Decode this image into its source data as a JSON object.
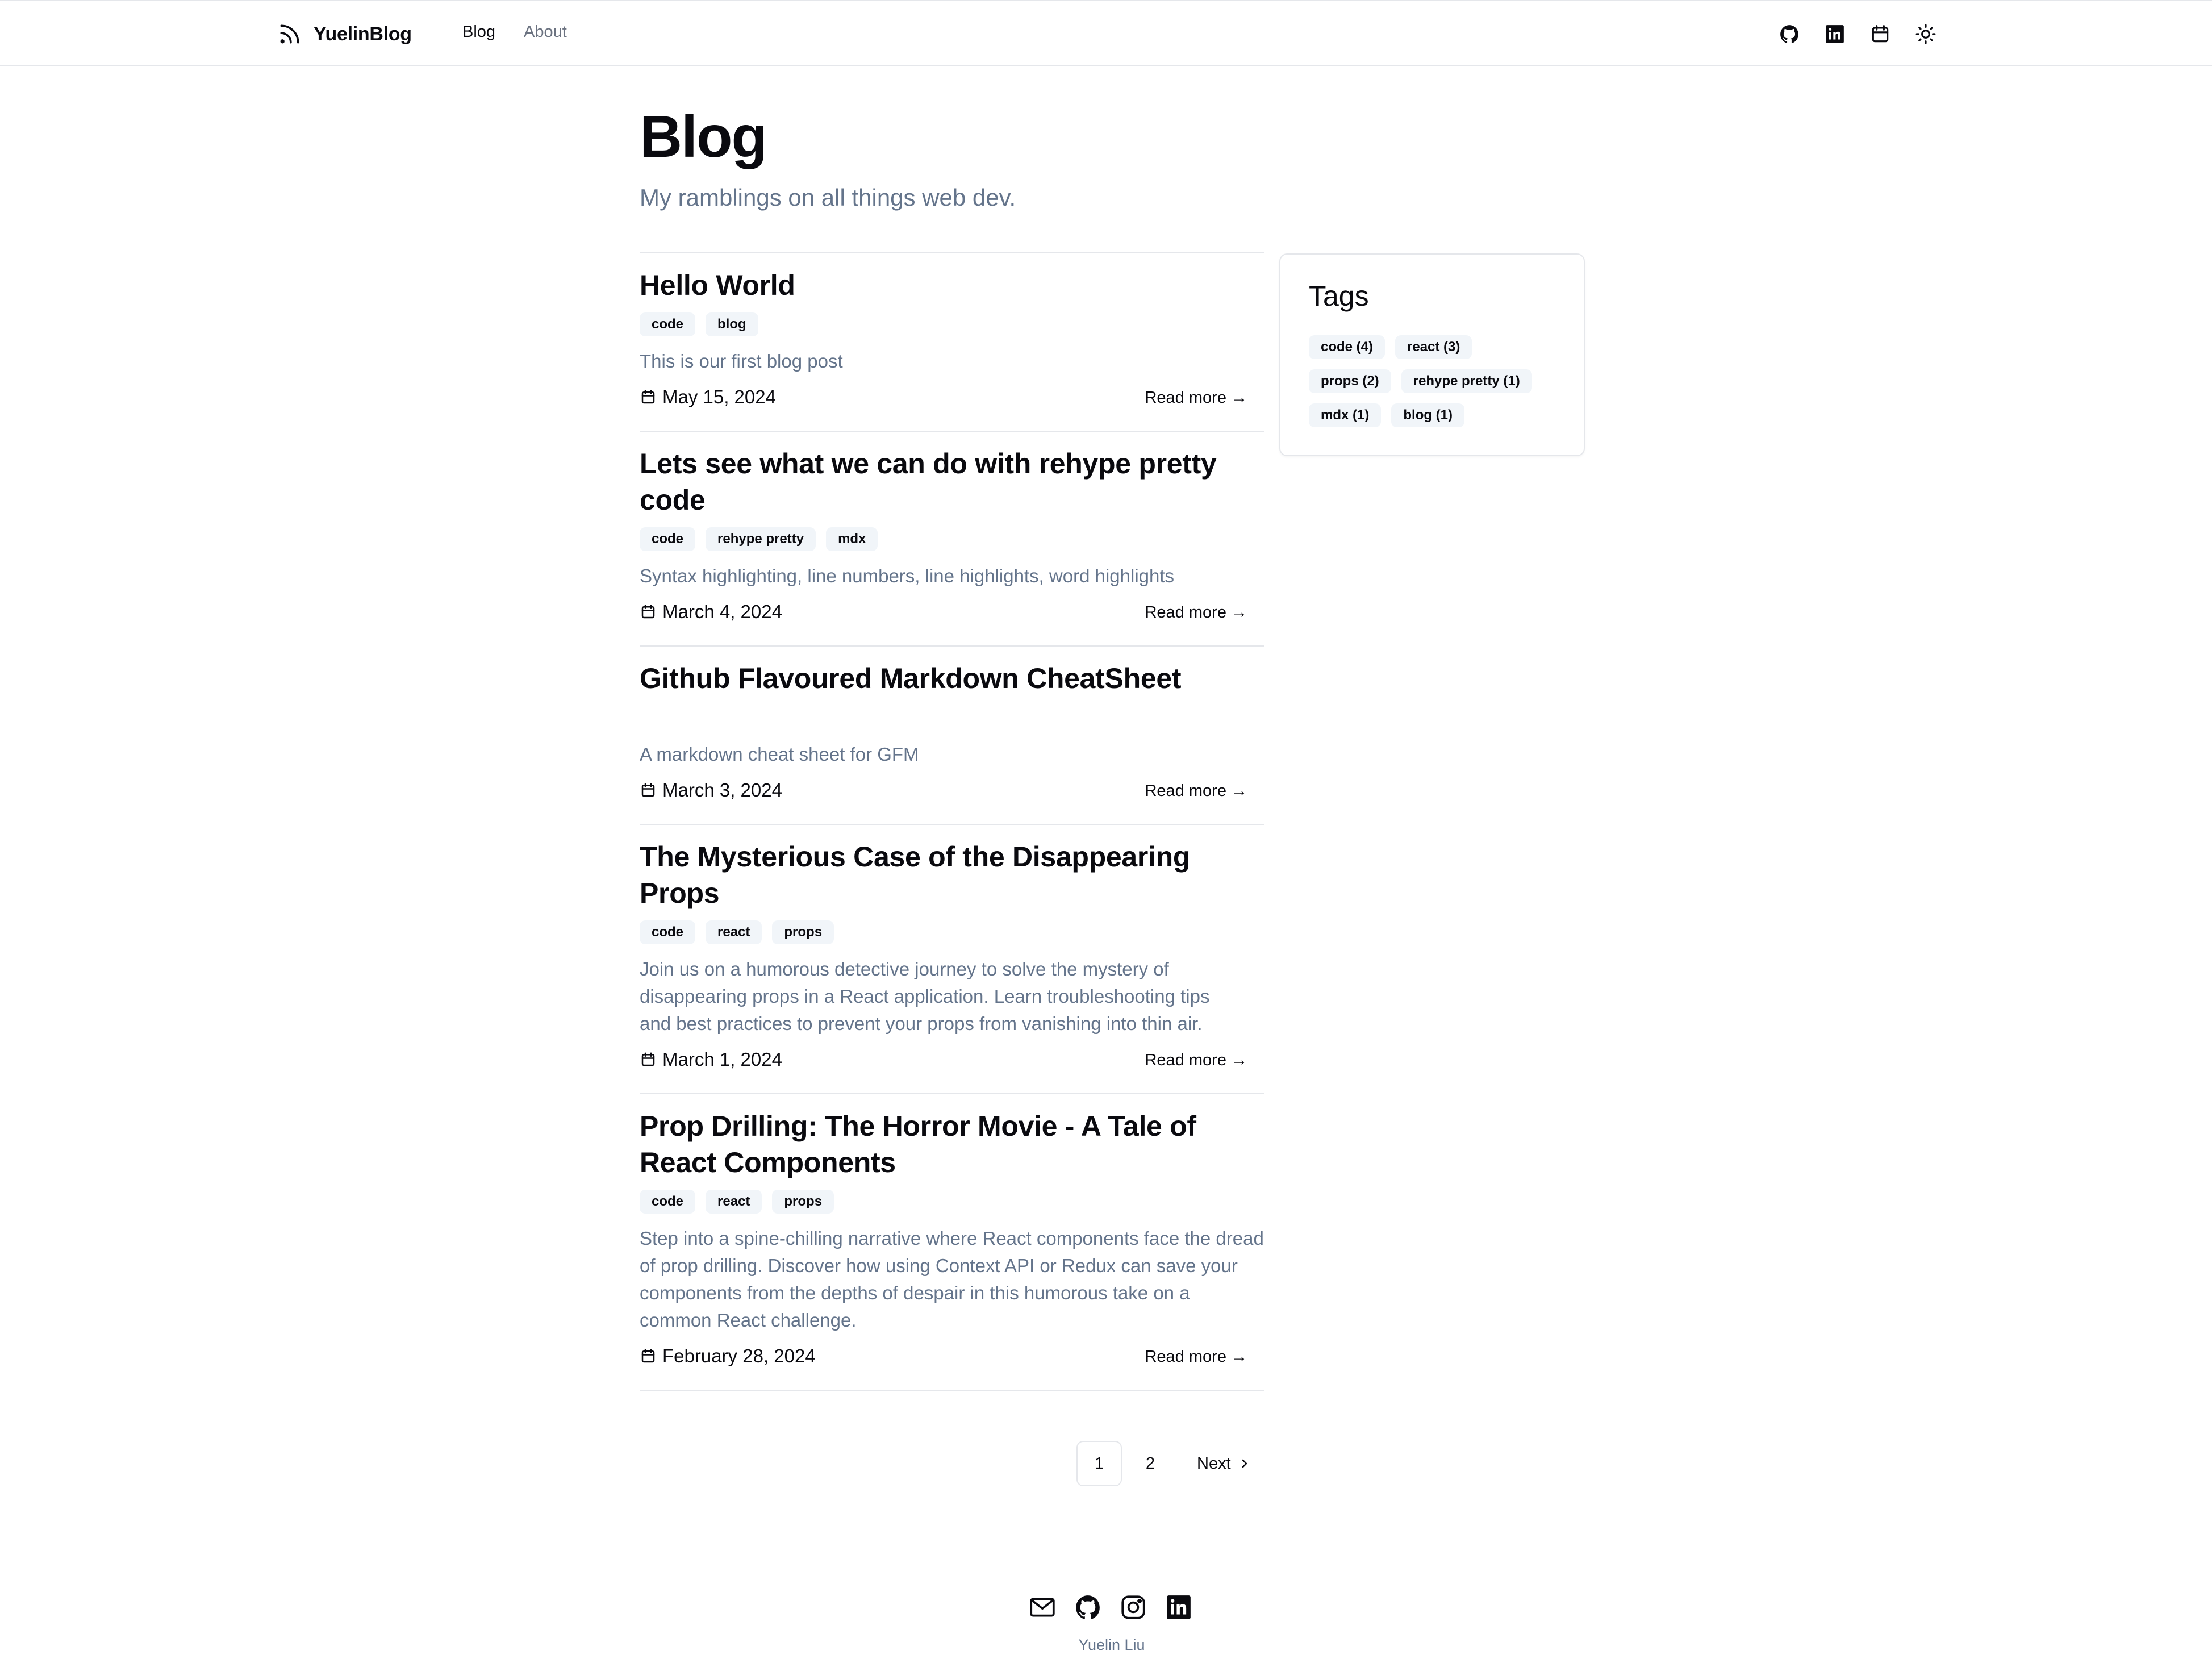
{
  "header": {
    "brand": "YuelinBlog",
    "nav": {
      "blog": "Blog",
      "about": "About"
    },
    "icons": [
      "github-icon",
      "linkedin-icon",
      "calendar-icon",
      "sun-icon"
    ]
  },
  "main": {
    "title": "Blog",
    "subtitle": "My ramblings on all things web dev."
  },
  "posts": [
    {
      "title": "Hello World",
      "tags": [
        "code",
        "blog"
      ],
      "description": "This is our first blog post",
      "date": "May 15, 2024",
      "read_more": "Read more →"
    },
    {
      "title": "Lets see what we can do with rehype pretty code",
      "tags": [
        "code",
        "rehype pretty",
        "mdx"
      ],
      "description": "Syntax highlighting, line numbers, line highlights, word highlights",
      "date": "March 4, 2024",
      "read_more": "Read more →"
    },
    {
      "title": "Github Flavoured Markdown CheatSheet",
      "tags": [],
      "description": "A markdown cheat sheet for GFM",
      "date": "March 3, 2024",
      "read_more": "Read more →"
    },
    {
      "title": "The Mysterious Case of the Disappearing Props",
      "tags": [
        "code",
        "react",
        "props"
      ],
      "description": "Join us on a humorous detective journey to solve the mystery of disappearing props in a React application. Learn troubleshooting tips and best practices to prevent your props from vanishing into thin air.",
      "date": "March 1, 2024",
      "read_more": "Read more →"
    },
    {
      "title": "Prop Drilling: The Horror Movie - A Tale of React Components",
      "tags": [
        "code",
        "react",
        "props"
      ],
      "description": "Step into a spine-chilling narrative where React components face the dread of prop drilling. Discover how using Context API or Redux can save your components from the depths of despair in this humorous take on a common React challenge.",
      "date": "February 28, 2024",
      "read_more": "Read more →"
    }
  ],
  "pagination": {
    "pages": [
      "1",
      "2"
    ],
    "current": "1",
    "next_label": "Next"
  },
  "sidebar": {
    "title": "Tags",
    "tags": [
      "code (4)",
      "react (3)",
      "props (2)",
      "rehype pretty (1)",
      "mdx (1)",
      "blog (1)"
    ]
  },
  "footer": {
    "icons": [
      "mail-icon",
      "github-icon",
      "instagram-icon",
      "linkedin-icon"
    ],
    "name": "Yuelin Liu"
  }
}
